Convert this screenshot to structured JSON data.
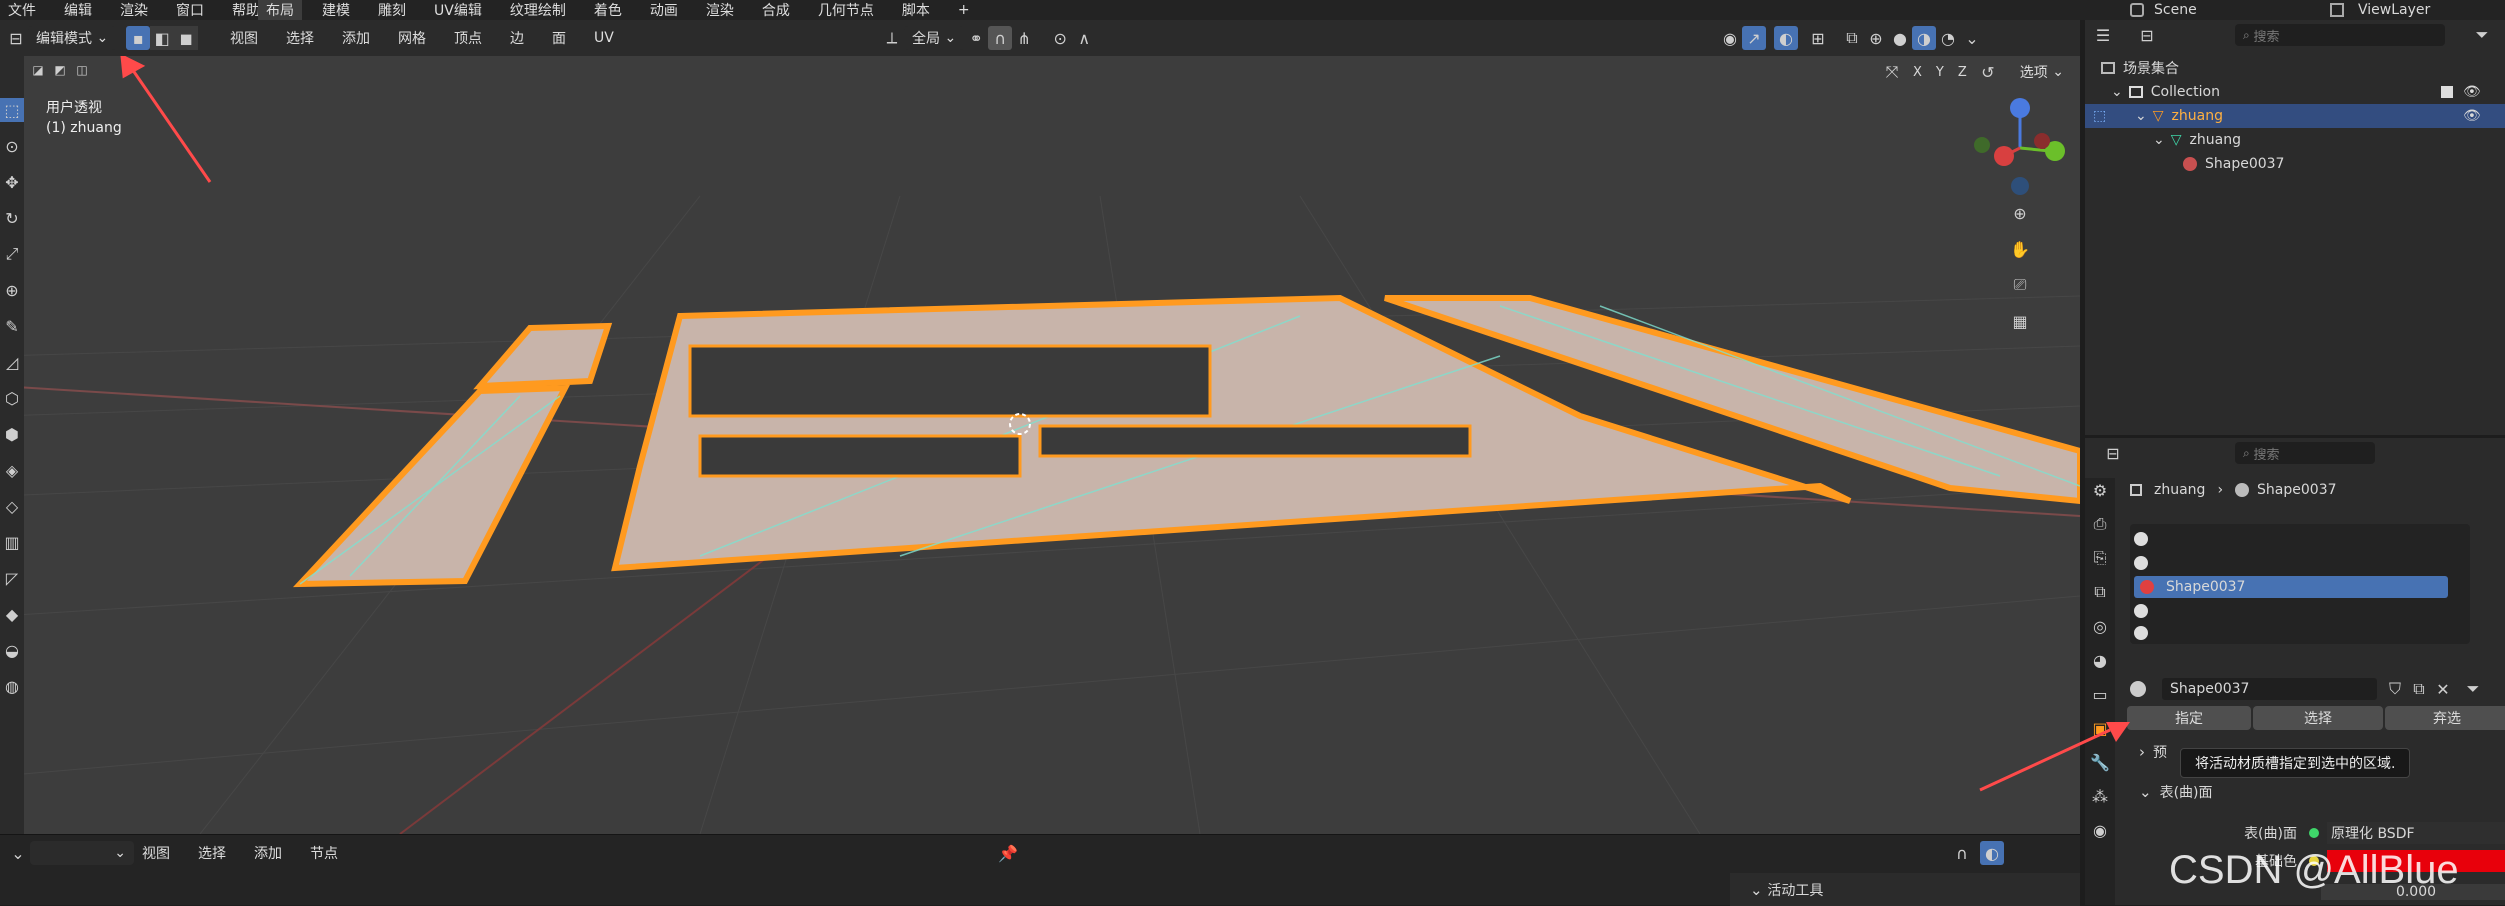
{
  "topbar": {
    "menus": [
      "文件",
      "编辑",
      "渲染",
      "窗口",
      "帮助"
    ],
    "workspaces": [
      "布局",
      "建模",
      "雕刻",
      "UV编辑",
      "纹理绘制",
      "着色",
      "动画",
      "渲染",
      "合成",
      "几何节点",
      "脚本"
    ],
    "add_tab": "+",
    "scene": "Scene",
    "view_layer": "ViewLayer"
  },
  "viewport_header": {
    "mode": "编辑模式",
    "menus": [
      "视图",
      "选择",
      "添加",
      "网格",
      "顶点",
      "边",
      "面",
      "UV"
    ],
    "transform": "全局",
    "axes": [
      "X",
      "Y",
      "Z"
    ],
    "options": "选项"
  },
  "viewport": {
    "view_name": "用户透视",
    "object_name": "(1) zhuang",
    "gizmo_axes": [
      "Z",
      "Y",
      "X"
    ]
  },
  "bottom_editor": {
    "menus": [
      "视图",
      "选择",
      "添加",
      "节点"
    ],
    "active_tool": "活动工具"
  },
  "outliner": {
    "search_placeholder": "搜索",
    "root": "场景集合",
    "collection": "Collection",
    "object": "zhuang",
    "mesh": "zhuang",
    "material": "Shape0037"
  },
  "properties": {
    "search_placeholder": "搜索",
    "breadcrumb": [
      "zhuang",
      "Shape0037"
    ],
    "slots": [
      "",
      "",
      "Shape0037",
      "",
      ""
    ],
    "material_name": "Shape0037",
    "buttons": {
      "assign": "指定",
      "select": "选择",
      "deselect": "弃选"
    },
    "tooltip": "将活动材质槽指定到选中的区域.",
    "preview_label": "预",
    "surface_panel": "表(曲)面",
    "surface_label": "表(曲)面",
    "surface_value": "原理化 BSDF",
    "base_color_label": "基础色",
    "metallic_value": "0.000",
    "base_color": "#e8000b"
  },
  "watermark": "CSDN @AllBlue",
  "colors": {
    "accent": "#4772b3",
    "selection_orange": "#ff9a1f",
    "edge_cyan": "#7fe0d0"
  }
}
